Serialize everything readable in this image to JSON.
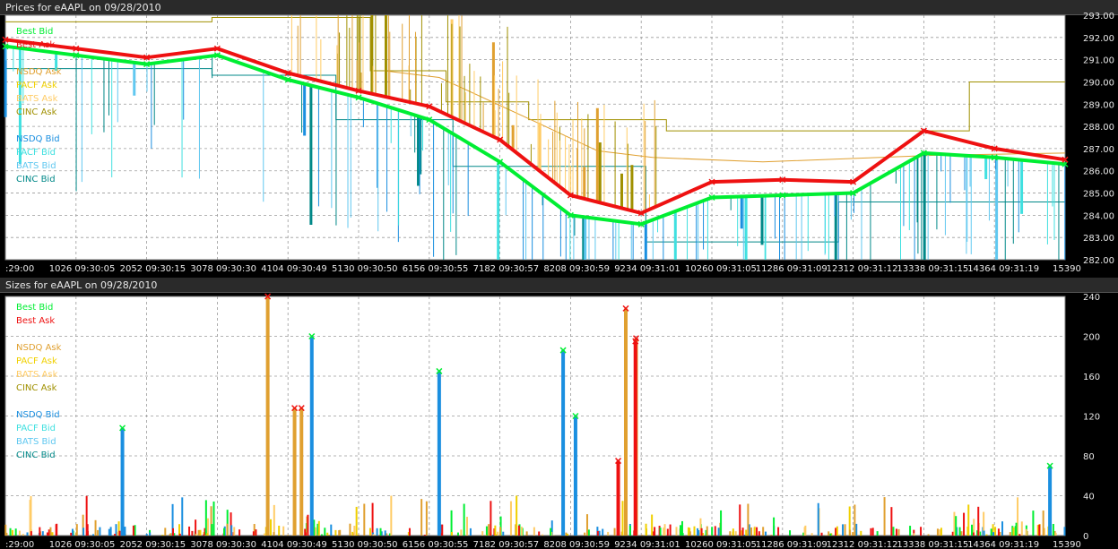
{
  "colors": {
    "best_bid": "#00ee33",
    "best_ask": "#ee1111",
    "nsdq_ask": "#e0a030",
    "pacf_ask": "#f0d000",
    "bats_ask": "#ffcc66",
    "cinc_ask": "#a09000",
    "nsdq_bid": "#1a8fe0",
    "pacf_bid": "#40e0e0",
    "bats_bid": "#60c8f0",
    "cinc_bid": "#008888"
  },
  "x_ticks": [
    ":29:00",
    "1026 09:30:05",
    "2052 09:30:15",
    "3078 09:30:30",
    "4104 09:30:49",
    "5130 09:30:50",
    "6156 09:30:55",
    "7182 09:30:57",
    "8208 09:30:59",
    "9234 09:31:01",
    "10260 09:31:05",
    "11286 09:31:09",
    "12312 09:31:12",
    "13338 09:31:15",
    "14364 09:31:19",
    "15390"
  ],
  "legend": {
    "best_bid": "Best Bid",
    "best_ask": "Best Ask",
    "nsdq_ask": "NSDQ Ask",
    "pacf_ask": "PACF Ask",
    "bats_ask": "BATS Ask",
    "cinc_ask": "CINC Ask",
    "nsdq_bid": "NSDQ Bid",
    "pacf_bid": "PACF Bid",
    "bats_bid": "BATS Bid",
    "cinc_bid": "CINC Bid"
  },
  "chart_data": [
    {
      "type": "line",
      "title": "Prices for  eAAPL  on  09/28/2010",
      "x_range": [
        0,
        15390
      ],
      "ylim": [
        282.0,
        293.0
      ],
      "y_ticks": [
        "293.00",
        "292.00",
        "291.00",
        "290.00",
        "289.00",
        "288.00",
        "287.00",
        "286.00",
        "285.00",
        "284.00",
        "283.00",
        "282.00"
      ],
      "grid": true,
      "legend_position": "top-left",
      "series": [
        {
          "name": "Best Ask",
          "x": [
            0,
            1026,
            2052,
            3078,
            4104,
            5130,
            6156,
            7182,
            8208,
            9234,
            10260,
            11286,
            12312,
            13338,
            14364,
            15390
          ],
          "values": [
            291.9,
            291.5,
            291.1,
            291.5,
            290.4,
            289.6,
            288.9,
            287.4,
            284.9,
            284.1,
            285.5,
            285.6,
            285.5,
            287.8,
            287.0,
            286.5
          ]
        },
        {
          "name": "Best Bid",
          "x": [
            0,
            1026,
            2052,
            3078,
            4104,
            5130,
            6156,
            7182,
            8208,
            9234,
            10260,
            11286,
            12312,
            13338,
            14364,
            15390
          ],
          "values": [
            291.6,
            291.2,
            290.8,
            291.2,
            290.1,
            289.3,
            288.3,
            286.4,
            284.0,
            283.6,
            284.8,
            284.9,
            285.0,
            286.8,
            286.6,
            286.3
          ]
        }
      ]
    },
    {
      "type": "bar",
      "title": "Sizes for  eAAPL  on  09/28/2010",
      "x_range": [
        0,
        15390
      ],
      "ylim": [
        0,
        240
      ],
      "y_ticks": [
        "240",
        "200",
        "160",
        "120",
        "80",
        "40",
        "0"
      ],
      "grid": true,
      "legend_position": "top-left",
      "series": [
        {
          "name": "NSDQ Bid",
          "x": [
            1700,
            4450,
            6300,
            8100,
            8280,
            15170
          ],
          "values": [
            108,
            200,
            165,
            186,
            120,
            70
          ]
        },
        {
          "name": "NSDQ Ask",
          "x": [
            3810,
            4200,
            4300,
            9010,
            9160
          ],
          "values": [
            240,
            128,
            128,
            228,
            198
          ]
        },
        {
          "name": "Best Ask",
          "x": [
            8900,
            9150
          ],
          "values": [
            75,
            195
          ]
        }
      ]
    }
  ]
}
